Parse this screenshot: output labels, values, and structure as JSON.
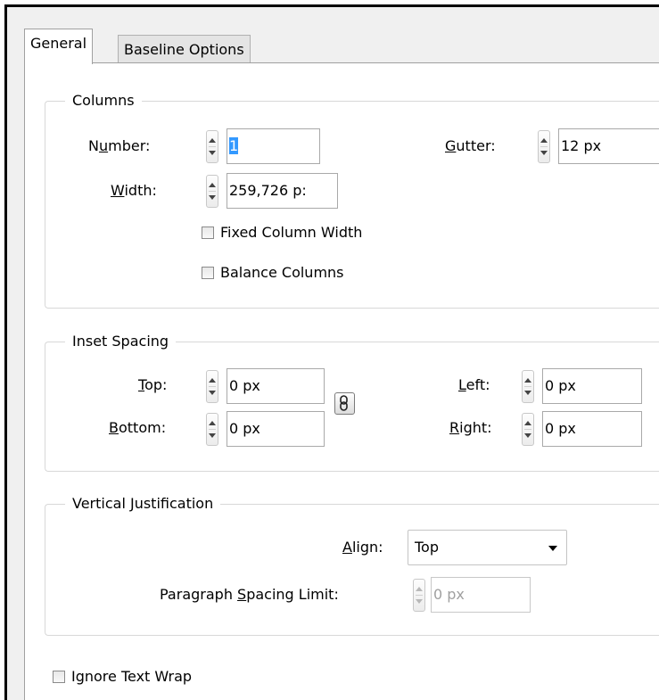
{
  "tabs": [
    {
      "label": "General",
      "active": true
    },
    {
      "label": "Baseline Options",
      "active": false
    }
  ],
  "columns": {
    "title": "Columns",
    "number_label_pre": "N",
    "number_label_key": "u",
    "number_label_post": "mber:",
    "number_value": "1",
    "gutter_label_key": "G",
    "gutter_label_post": "utter:",
    "gutter_value": "12 px",
    "width_label_key": "W",
    "width_label_post": "idth:",
    "width_value": "259,726 p:",
    "fixed_column_width": "Fixed Column Width",
    "balance_columns": "Balance Columns"
  },
  "inset": {
    "title": "Inset Spacing",
    "top_key": "T",
    "top_post": "op:",
    "top_value": "0 px",
    "bottom_key": "B",
    "bottom_post": "ottom:",
    "bottom_value": "0 px",
    "left_key": "L",
    "left_post": "eft:",
    "left_value": "0 px",
    "right_key": "R",
    "right_post": "ight:",
    "right_value": "0 px"
  },
  "vertical": {
    "title": "Vertical Justification",
    "align_key": "A",
    "align_post": "lign:",
    "align_value": "Top",
    "limit_pre": "Paragraph ",
    "limit_key": "S",
    "limit_post": "pacing Limit:",
    "limit_value": "0 px"
  },
  "ignore_text_wrap": "Ignore Text Wrap",
  "icons": {
    "spinner": "spinner-arrows-icon",
    "chain": "chain-link-icon",
    "dropdown": "chevron-down-icon"
  }
}
